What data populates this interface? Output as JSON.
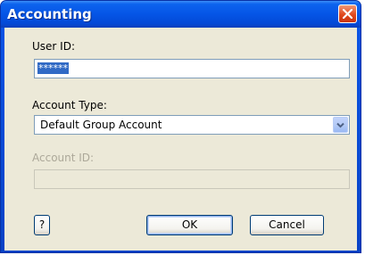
{
  "window": {
    "title": "Accounting"
  },
  "fields": {
    "user_id_label": "User ID:",
    "user_id_value": "******",
    "account_type_label": "Account Type:",
    "account_type_value": "Default Group Account",
    "account_id_label": "Account ID:",
    "account_id_value": ""
  },
  "buttons": {
    "help_label": "?",
    "ok_label": "OK",
    "cancel_label": "Cancel"
  },
  "icons": {
    "close": "close-icon",
    "dropdown": "chevron-down-icon"
  },
  "colors": {
    "titlebar": "#0555e6",
    "close": "#e0481d",
    "dialog_bg": "#ece9d8",
    "selection": "#316ac5"
  }
}
